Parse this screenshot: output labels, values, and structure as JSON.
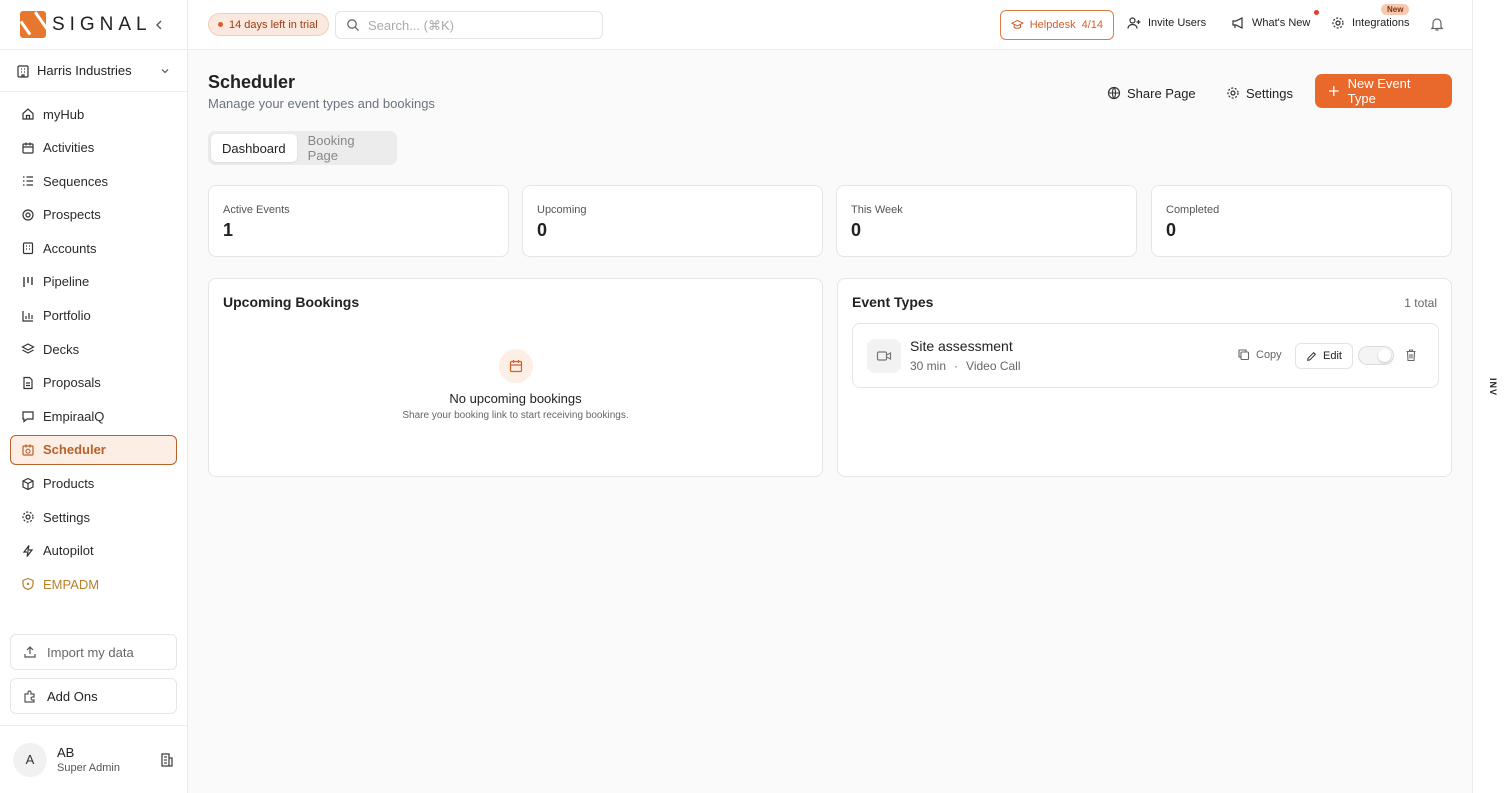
{
  "brand": {
    "name": "SIGNAL",
    "accent": "#e8692b"
  },
  "sidebar": {
    "org": "Harris Industries",
    "items": [
      {
        "label": "myHub",
        "icon": "home-icon"
      },
      {
        "label": "Activities",
        "icon": "calendar-icon"
      },
      {
        "label": "Sequences",
        "icon": "list-icon"
      },
      {
        "label": "Prospects",
        "icon": "target-icon"
      },
      {
        "label": "Accounts",
        "icon": "building-icon"
      },
      {
        "label": "Pipeline",
        "icon": "kanban-icon"
      },
      {
        "label": "Portfolio",
        "icon": "bar-chart-icon"
      },
      {
        "label": "Decks",
        "icon": "layers-icon"
      },
      {
        "label": "Proposals",
        "icon": "document-icon"
      },
      {
        "label": "EmpiraalQ",
        "icon": "message-icon"
      },
      {
        "label": "Scheduler",
        "icon": "calendar-clock-icon",
        "active": true
      },
      {
        "label": "Products",
        "icon": "package-icon"
      },
      {
        "label": "Settings",
        "icon": "gear-icon"
      },
      {
        "label": "Autopilot",
        "icon": "zap-icon"
      },
      {
        "label": "EMPADM",
        "icon": "shield-icon"
      }
    ],
    "import_label": "Import my data",
    "addons_label": "Add Ons",
    "user": {
      "initial": "A",
      "name": "AB",
      "role": "Super Admin"
    }
  },
  "topbar": {
    "trial": "14 days left in trial",
    "search_placeholder": "Search... (⌘K)",
    "helpdesk": "Helpdesk",
    "helpdesk_count": "4/14",
    "invite": "Invite Users",
    "whats_new": "What's New",
    "integrations": "Integrations",
    "new_badge": "New"
  },
  "right_strip": {
    "tag": "INV"
  },
  "page": {
    "title": "Scheduler",
    "subtitle": "Manage your event types and bookings",
    "share": "Share Page",
    "settings": "Settings",
    "new_event": "New Event Type",
    "tabs": [
      {
        "label": "Dashboard",
        "active": true
      },
      {
        "label": "Booking Page"
      }
    ],
    "stats": [
      {
        "label": "Active Events",
        "value": "1"
      },
      {
        "label": "Upcoming",
        "value": "0"
      },
      {
        "label": "This Week",
        "value": "0"
      },
      {
        "label": "Completed",
        "value": "0"
      }
    ],
    "upcoming": {
      "title": "Upcoming Bookings",
      "empty_title": "No upcoming bookings",
      "empty_sub": "Share your booking link to start receiving bookings."
    },
    "event_types": {
      "title": "Event Types",
      "total": "1 total",
      "items": [
        {
          "name": "Site assessment",
          "duration": "30 min",
          "separator": "·",
          "type": "Video Call",
          "copy": "Copy",
          "edit": "Edit"
        }
      ]
    }
  }
}
